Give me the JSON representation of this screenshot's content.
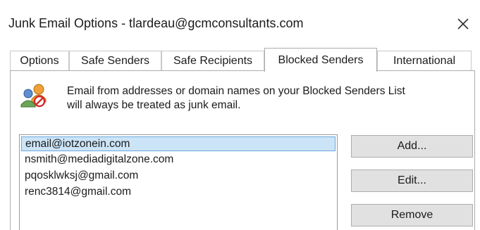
{
  "window": {
    "title": "Junk Email Options - tlardeau@gcmconsultants.com",
    "close_icon": "close-icon"
  },
  "tabs": [
    {
      "label": "Options",
      "active": false
    },
    {
      "label": "Safe Senders",
      "active": false
    },
    {
      "label": "Safe Recipients",
      "active": false
    },
    {
      "label": "Blocked Senders",
      "active": true
    },
    {
      "label": "International",
      "active": false
    }
  ],
  "blocked_senders": {
    "icon": "blocked-users-icon",
    "description_line1": "Email from addresses or domain names on your Blocked Senders List",
    "description_line2": "will always be treated as junk email.",
    "list": [
      {
        "address": "email@iotzonein.com",
        "selected": true
      },
      {
        "address": "nsmith@mediadigitalzone.com",
        "selected": false
      },
      {
        "address": "pqosklwksj@gmail.com",
        "selected": false
      },
      {
        "address": "renc3814@gmail.com",
        "selected": false
      }
    ],
    "buttons": {
      "add": "Add...",
      "edit": "Edit...",
      "remove": "Remove"
    }
  },
  "colors": {
    "selection_fill": "#cce4f7",
    "selection_border": "#6aa8de",
    "button_face": "#e1e1e1"
  }
}
